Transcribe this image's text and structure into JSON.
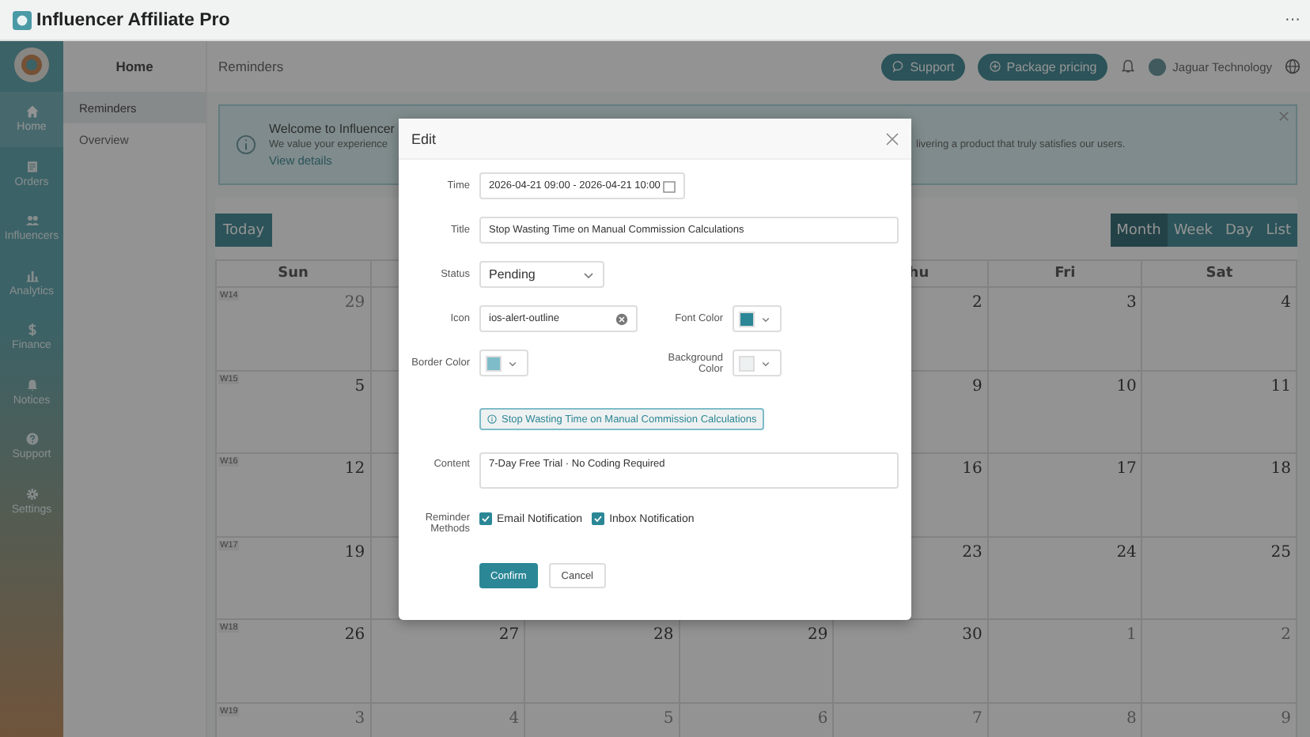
{
  "window": {
    "title": "Influencer Affiliate Pro",
    "menu": "···"
  },
  "nav": {
    "items": [
      {
        "label": "Home",
        "selected": true
      },
      {
        "label": "Orders",
        "selected": false
      },
      {
        "label": "Influencers",
        "selected": false
      },
      {
        "label": "Analytics",
        "selected": false
      },
      {
        "label": "Finance",
        "selected": false
      },
      {
        "label": "Notices",
        "selected": false
      },
      {
        "label": "Support",
        "selected": false
      },
      {
        "label": "Settings",
        "selected": false
      }
    ]
  },
  "subnav": {
    "title": "Home",
    "items": [
      {
        "label": "Reminders",
        "selected": true
      },
      {
        "label": "Overview",
        "selected": false
      }
    ]
  },
  "topbar": {
    "breadcrumb": "Reminders",
    "buttons": [
      "Support",
      "Package pricing"
    ],
    "user": "Jaguar Technology"
  },
  "alert": {
    "title": "Welcome to Influencer",
    "text": "We value your experience",
    "text_tail": "livering a product that truly satisfies our users.",
    "link": "View details"
  },
  "calendar": {
    "today": "Today",
    "views": [
      {
        "label": "Month",
        "selected": true
      },
      {
        "label": "Week",
        "selected": false
      },
      {
        "label": "Day",
        "selected": false
      },
      {
        "label": "List",
        "selected": false
      }
    ],
    "weekdays": {
      "sun": "Sun",
      "thu": "hu",
      "fri": "Fri",
      "sat": "Sat"
    },
    "weeks": [
      {
        "week": "W14",
        "days": {
          "sun": {
            "day": "29",
            "muted": true
          },
          "thu": {
            "day": "2",
            "muted": false
          },
          "fri": {
            "day": "3",
            "muted": false
          },
          "sat": {
            "day": "4",
            "muted": false
          }
        }
      },
      {
        "week": "W15",
        "days": {
          "sun": {
            "day": "5",
            "muted": false
          },
          "thu": {
            "day": "9",
            "muted": false
          },
          "fri": {
            "day": "10",
            "muted": false
          },
          "sat": {
            "day": "11",
            "muted": false
          }
        }
      },
      {
        "week": "W16",
        "days": {
          "sun": {
            "day": "12",
            "muted": false
          },
          "thu": {
            "day": "16",
            "muted": false
          },
          "fri": {
            "day": "17",
            "muted": false
          },
          "sat": {
            "day": "18",
            "muted": false
          }
        }
      },
      {
        "week": "W17",
        "days": {
          "sun": {
            "day": "19",
            "muted": false
          },
          "thu": {
            "day": "23",
            "muted": false
          },
          "fri": {
            "day": "24",
            "muted": false
          },
          "sat": {
            "day": "25",
            "muted": false
          }
        }
      },
      {
        "week": "W18",
        "days": {
          "sun": {
            "day": "26",
            "muted": false
          },
          "mon": {
            "day": "27",
            "muted": false
          },
          "tue": {
            "day": "28",
            "muted": false
          },
          "wed": {
            "day": "29",
            "muted": false
          },
          "thu": {
            "day": "30",
            "muted": false
          },
          "fri": {
            "day": "1",
            "muted": true
          },
          "sat": {
            "day": "2",
            "muted": true
          }
        }
      },
      {
        "week": "W19",
        "days": {
          "sun": {
            "day": "3",
            "muted": true
          },
          "mon": {
            "day": "4",
            "muted": true
          },
          "tue": {
            "day": "5",
            "muted": true
          },
          "wed": {
            "day": "6",
            "muted": true
          },
          "thu": {
            "day": "7",
            "muted": true
          },
          "fri": {
            "day": "8",
            "muted": true
          },
          "sat": {
            "day": "9",
            "muted": true
          }
        }
      }
    ]
  },
  "dialog": {
    "title": "Edit",
    "time": {
      "label": "Time",
      "value": "2026-04-21 09:00 - 2026-04-21 10:00"
    },
    "title_field": {
      "label": "Title",
      "value": "Stop Wasting Time on Manual Commission Calculations"
    },
    "status": {
      "label": "Status",
      "value": "Pending"
    },
    "icon": {
      "label": "Icon",
      "value": "ios-alert-outline"
    },
    "font_color": {
      "label": "Font Color",
      "color": "#2b8796"
    },
    "border_color": {
      "label": "Border Color",
      "color": "#7dbcc8"
    },
    "background_color": {
      "label": "Background Color",
      "color": "#eef1f1"
    },
    "preview": {
      "text": "Stop Wasting Time on Manual Commission Calculations"
    },
    "content": {
      "label": "Content",
      "value": "7-Day Free Trial · No Coding Required"
    },
    "reminder_methods": {
      "label": "Reminder Methods",
      "options": [
        {
          "label": "Email Notification",
          "checked": true
        },
        {
          "label": "Inbox Notification",
          "checked": true
        }
      ]
    },
    "confirm": "Confirm",
    "cancel": "Cancel"
  }
}
